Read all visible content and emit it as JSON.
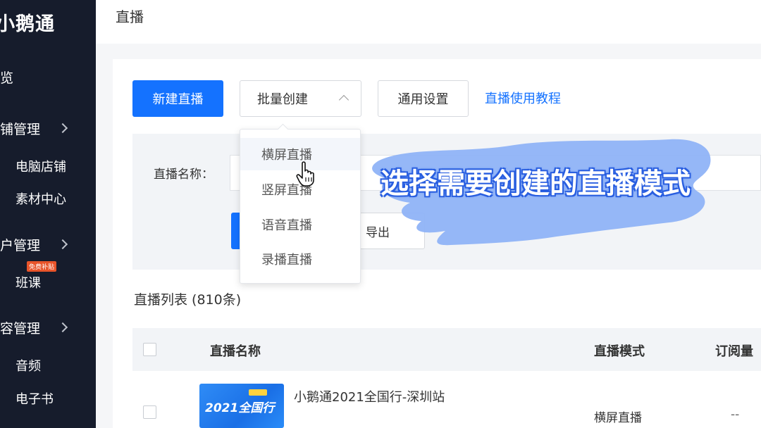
{
  "sidebar": {
    "logo": "小鹅通",
    "items": [
      {
        "label": "总览"
      },
      {
        "label": "店铺管理"
      },
      {
        "label": "电脑店铺"
      },
      {
        "label": "素材中心"
      },
      {
        "label": "用户管理"
      },
      {
        "label": "班课"
      },
      {
        "label": "内容管理"
      },
      {
        "label": "音频"
      },
      {
        "label": "电子书"
      }
    ],
    "badge": "免费补贴"
  },
  "header": {
    "title": "直播"
  },
  "toolbar": {
    "new_live": "新建直播",
    "batch_create": "批量创建",
    "general_settings": "通用设置",
    "tutorial_link": "直播使用教程"
  },
  "filter": {
    "name_label": "直播名称：",
    "export_label": "导出"
  },
  "dropdown": {
    "items": [
      "横屏直播",
      "竖屏直播",
      "语音直播",
      "录播直播"
    ]
  },
  "caption": "选择需要创建的直播模式",
  "list": {
    "title": "直播列表 (810条)",
    "columns": [
      "直播名称",
      "直播模式",
      "订阅量"
    ],
    "rows": [
      {
        "name": "小鹅通2021全国行-深圳站",
        "thumb_text": "2021全国行",
        "mode": "横屏直播",
        "subscriptions": "--"
      }
    ]
  },
  "colors": {
    "primary": "#1472ff",
    "sidebar": "#161c2c",
    "caption_highlight": "#8fb3f7"
  }
}
